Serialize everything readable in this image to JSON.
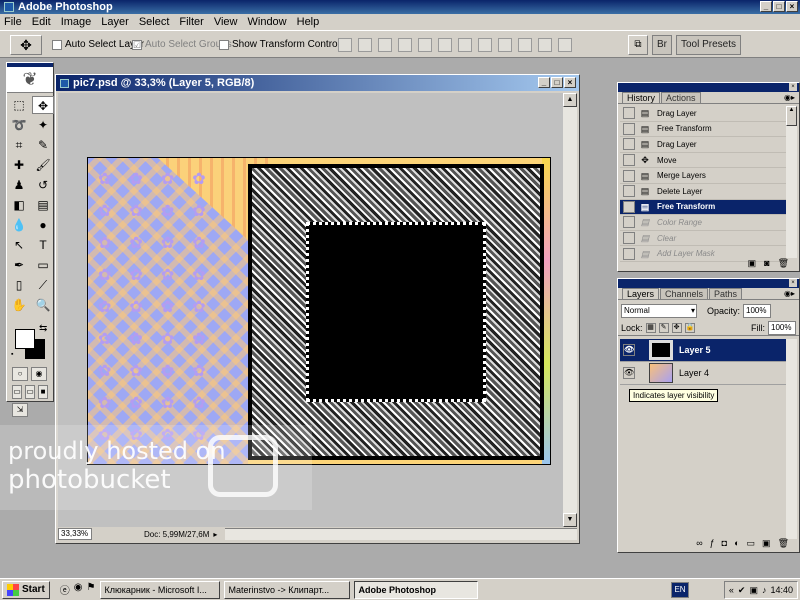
{
  "window": {
    "title": "Adobe Photoshop"
  },
  "menu": [
    "File",
    "Edit",
    "Image",
    "Layer",
    "Select",
    "Filter",
    "View",
    "Window",
    "Help"
  ],
  "options": {
    "auto_select_layer": "Auto Select Layer",
    "auto_select_groups": "Auto Select Groups",
    "show_transform_controls": "Show Transform Controls",
    "auto_select_groups_checked": "☑",
    "tool_presets_tab": "Tool Presets",
    "brushes_tab": "Br"
  },
  "document": {
    "title": "pic7.psd @ 33,3% (Layer 5, RGB/8)",
    "zoom": "33,33%",
    "doc_size": "Doc: 5,99M/27,6M"
  },
  "watermark": {
    "line1": "proudly hosted on",
    "line2": "photobucket"
  },
  "history": {
    "tabs": [
      "History",
      "Actions"
    ],
    "items": [
      {
        "label": "Drag Layer",
        "state": "normal"
      },
      {
        "label": "Free Transform",
        "state": "normal"
      },
      {
        "label": "Drag Layer",
        "state": "normal"
      },
      {
        "label": "Move",
        "state": "normal"
      },
      {
        "label": "Merge Layers",
        "state": "normal"
      },
      {
        "label": "Delete Layer",
        "state": "normal"
      },
      {
        "label": "Free Transform",
        "state": "selected"
      },
      {
        "label": "Color Range",
        "state": "dim"
      },
      {
        "label": "Clear",
        "state": "dim"
      },
      {
        "label": "Add Layer Mask",
        "state": "dim"
      }
    ]
  },
  "layers": {
    "tabs": [
      "Layers",
      "Channels",
      "Paths"
    ],
    "blend_mode": "Normal",
    "opacity_label": "Opacity:",
    "opacity": "100%",
    "lock_label": "Lock:",
    "fill_label": "Fill:",
    "fill": "100%",
    "items": [
      {
        "name": "Layer 5",
        "selected": true
      },
      {
        "name": "Layer 4",
        "selected": false
      }
    ],
    "tooltip": "Indicates layer visibility"
  },
  "taskbar": {
    "start": "Start",
    "tasks": [
      {
        "label": "Клюкарник - Microsoft I...",
        "active": false
      },
      {
        "label": "Materinstvo -> Клипарт...",
        "active": false
      },
      {
        "label": "Adobe Photoshop",
        "active": true
      }
    ],
    "lang": "EN",
    "clock": "14:40"
  },
  "colors": {
    "accent": "#0a246a",
    "face": "#d4d0c8"
  }
}
